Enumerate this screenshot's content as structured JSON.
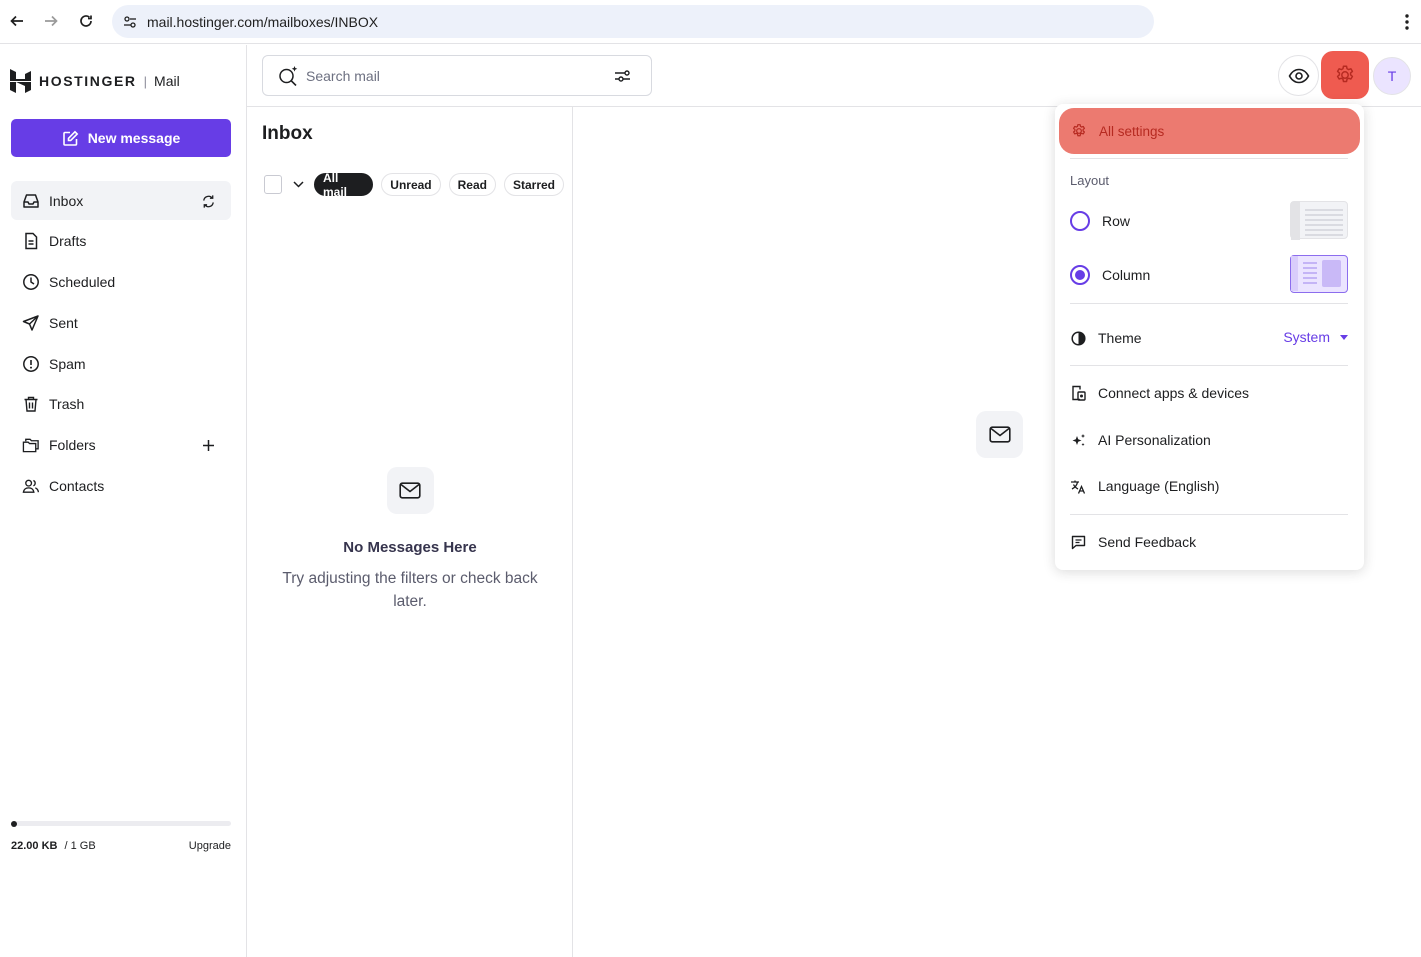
{
  "browser": {
    "url": "mail.hostinger.com/mailboxes/INBOX"
  },
  "brand": {
    "name": "HOSTINGER",
    "separator": "|",
    "product": "Mail",
    "accent": "#673de6",
    "alert": "#ef5b50"
  },
  "sidebar": {
    "new_message": "New message",
    "items": [
      {
        "label": "Inbox",
        "icon": "inbox-icon"
      },
      {
        "label": "Drafts",
        "icon": "drafts-icon"
      },
      {
        "label": "Scheduled",
        "icon": "clock-icon"
      },
      {
        "label": "Sent",
        "icon": "send-icon"
      },
      {
        "label": "Spam",
        "icon": "alert-circle-icon"
      },
      {
        "label": "Trash",
        "icon": "trash-icon"
      },
      {
        "label": "Folders",
        "icon": "folders-icon"
      },
      {
        "label": "Contacts",
        "icon": "contacts-icon"
      }
    ],
    "storage": {
      "used": "22.00 KB",
      "total": "/ 1 GB",
      "used_fraction": 0.02,
      "upgrade": "Upgrade"
    }
  },
  "header": {
    "search_placeholder": "Search mail",
    "avatar_initial": "T"
  },
  "list": {
    "title": "Inbox",
    "filters": [
      "All mail",
      "Unread",
      "Read",
      "Starred"
    ],
    "active_filter": "All mail",
    "empty_title": "No Messages Here",
    "empty_sub": "Try adjusting the filters or check back later."
  },
  "settings_menu": {
    "all_settings": "All settings",
    "layout_label": "Layout",
    "layout_options": [
      {
        "label": "Row",
        "selected": false
      },
      {
        "label": "Column",
        "selected": true
      }
    ],
    "theme_label": "Theme",
    "theme_value": "System",
    "items": [
      {
        "label": "Connect apps & devices",
        "icon": "connect-devices-icon"
      },
      {
        "label": "AI Personalization",
        "icon": "sparkle-icon"
      },
      {
        "label": "Language (English)",
        "icon": "translate-icon"
      }
    ],
    "feedback": "Send Feedback"
  }
}
